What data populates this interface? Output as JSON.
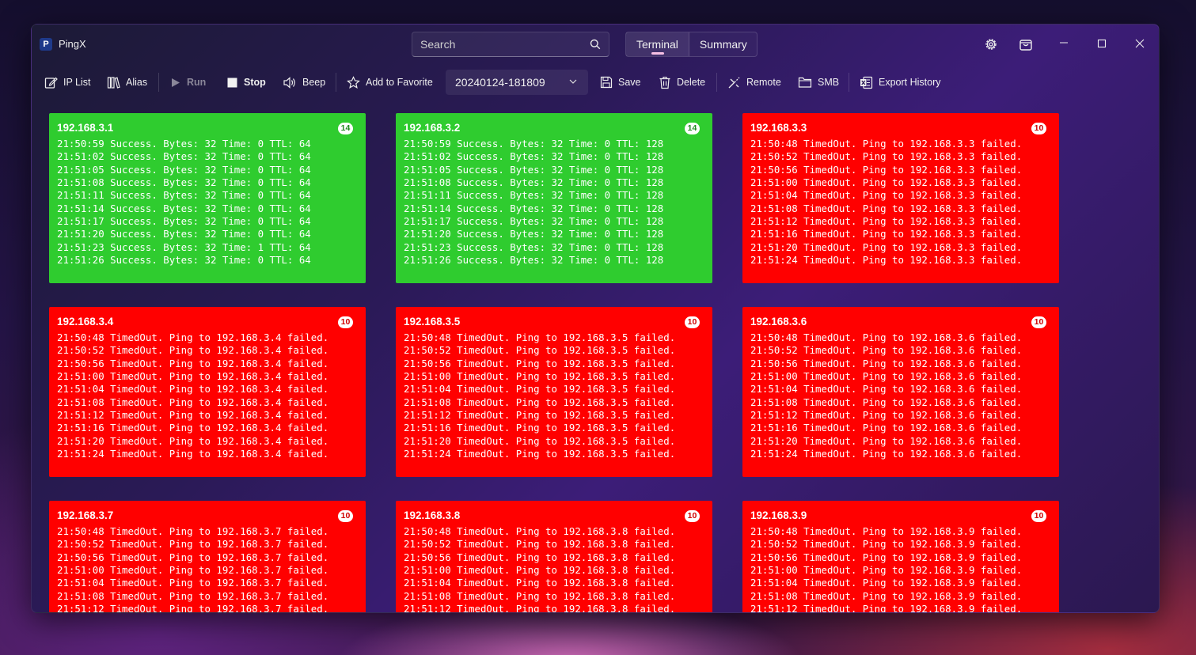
{
  "app": {
    "icon_letter": "P",
    "title": "PingX"
  },
  "search": {
    "placeholder": "Search"
  },
  "tabs": [
    "Terminal",
    "Summary"
  ],
  "toolbar": {
    "ip_list": "IP List",
    "alias": "Alias",
    "run": "Run",
    "stop": "Stop",
    "beep": "Beep",
    "add_favorite": "Add to Favorite",
    "history_selected": "20240124-181809",
    "save": "Save",
    "delete": "Delete",
    "remote": "Remote",
    "smb": "SMB",
    "export_history": "Export History"
  },
  "colors": {
    "success": "#2fcc2f",
    "failure": "#ff0000"
  },
  "cards": [
    {
      "ip": "192.168.3.1",
      "count": "14",
      "status": "success",
      "lines": [
        "21:50:59 Success. Bytes: 32 Time: 0 TTL: 64",
        "21:51:02 Success. Bytes: 32 Time: 0 TTL: 64",
        "21:51:05 Success. Bytes: 32 Time: 0 TTL: 64",
        "21:51:08 Success. Bytes: 32 Time: 0 TTL: 64",
        "21:51:11 Success. Bytes: 32 Time: 0 TTL: 64",
        "21:51:14 Success. Bytes: 32 Time: 0 TTL: 64",
        "21:51:17 Success. Bytes: 32 Time: 0 TTL: 64",
        "21:51:20 Success. Bytes: 32 Time: 0 TTL: 64",
        "21:51:23 Success. Bytes: 32 Time: 1 TTL: 64",
        "21:51:26 Success. Bytes: 32 Time: 0 TTL: 64"
      ]
    },
    {
      "ip": "192.168.3.2",
      "count": "14",
      "status": "success",
      "lines": [
        "21:50:59 Success. Bytes: 32 Time: 0 TTL: 128",
        "21:51:02 Success. Bytes: 32 Time: 0 TTL: 128",
        "21:51:05 Success. Bytes: 32 Time: 0 TTL: 128",
        "21:51:08 Success. Bytes: 32 Time: 0 TTL: 128",
        "21:51:11 Success. Bytes: 32 Time: 0 TTL: 128",
        "21:51:14 Success. Bytes: 32 Time: 0 TTL: 128",
        "21:51:17 Success. Bytes: 32 Time: 0 TTL: 128",
        "21:51:20 Success. Bytes: 32 Time: 0 TTL: 128",
        "21:51:23 Success. Bytes: 32 Time: 0 TTL: 128",
        "21:51:26 Success. Bytes: 32 Time: 0 TTL: 128"
      ]
    },
    {
      "ip": "192.168.3.3",
      "count": "10",
      "status": "failure",
      "lines": [
        "21:50:48 TimedOut. Ping to 192.168.3.3 failed.",
        "21:50:52 TimedOut. Ping to 192.168.3.3 failed.",
        "21:50:56 TimedOut. Ping to 192.168.3.3 failed.",
        "21:51:00 TimedOut. Ping to 192.168.3.3 failed.",
        "21:51:04 TimedOut. Ping to 192.168.3.3 failed.",
        "21:51:08 TimedOut. Ping to 192.168.3.3 failed.",
        "21:51:12 TimedOut. Ping to 192.168.3.3 failed.",
        "21:51:16 TimedOut. Ping to 192.168.3.3 failed.",
        "21:51:20 TimedOut. Ping to 192.168.3.3 failed.",
        "21:51:24 TimedOut. Ping to 192.168.3.3 failed."
      ]
    },
    {
      "ip": "192.168.3.4",
      "count": "10",
      "status": "failure",
      "lines": [
        "21:50:48 TimedOut. Ping to 192.168.3.4 failed.",
        "21:50:52 TimedOut. Ping to 192.168.3.4 failed.",
        "21:50:56 TimedOut. Ping to 192.168.3.4 failed.",
        "21:51:00 TimedOut. Ping to 192.168.3.4 failed.",
        "21:51:04 TimedOut. Ping to 192.168.3.4 failed.",
        "21:51:08 TimedOut. Ping to 192.168.3.4 failed.",
        "21:51:12 TimedOut. Ping to 192.168.3.4 failed.",
        "21:51:16 TimedOut. Ping to 192.168.3.4 failed.",
        "21:51:20 TimedOut. Ping to 192.168.3.4 failed.",
        "21:51:24 TimedOut. Ping to 192.168.3.4 failed."
      ]
    },
    {
      "ip": "192.168.3.5",
      "count": "10",
      "status": "failure",
      "lines": [
        "21:50:48 TimedOut. Ping to 192.168.3.5 failed.",
        "21:50:52 TimedOut. Ping to 192.168.3.5 failed.",
        "21:50:56 TimedOut. Ping to 192.168.3.5 failed.",
        "21:51:00 TimedOut. Ping to 192.168.3.5 failed.",
        "21:51:04 TimedOut. Ping to 192.168.3.5 failed.",
        "21:51:08 TimedOut. Ping to 192.168.3.5 failed.",
        "21:51:12 TimedOut. Ping to 192.168.3.5 failed.",
        "21:51:16 TimedOut. Ping to 192.168.3.5 failed.",
        "21:51:20 TimedOut. Ping to 192.168.3.5 failed.",
        "21:51:24 TimedOut. Ping to 192.168.3.5 failed."
      ]
    },
    {
      "ip": "192.168.3.6",
      "count": "10",
      "status": "failure",
      "lines": [
        "21:50:48 TimedOut. Ping to 192.168.3.6 failed.",
        "21:50:52 TimedOut. Ping to 192.168.3.6 failed.",
        "21:50:56 TimedOut. Ping to 192.168.3.6 failed.",
        "21:51:00 TimedOut. Ping to 192.168.3.6 failed.",
        "21:51:04 TimedOut. Ping to 192.168.3.6 failed.",
        "21:51:08 TimedOut. Ping to 192.168.3.6 failed.",
        "21:51:12 TimedOut. Ping to 192.168.3.6 failed.",
        "21:51:16 TimedOut. Ping to 192.168.3.6 failed.",
        "21:51:20 TimedOut. Ping to 192.168.3.6 failed.",
        "21:51:24 TimedOut. Ping to 192.168.3.6 failed."
      ]
    },
    {
      "ip": "192.168.3.7",
      "count": "10",
      "status": "failure",
      "lines": [
        "21:50:48 TimedOut. Ping to 192.168.3.7 failed.",
        "21:50:52 TimedOut. Ping to 192.168.3.7 failed.",
        "21:50:56 TimedOut. Ping to 192.168.3.7 failed.",
        "21:51:00 TimedOut. Ping to 192.168.3.7 failed.",
        "21:51:04 TimedOut. Ping to 192.168.3.7 failed.",
        "21:51:08 TimedOut. Ping to 192.168.3.7 failed.",
        "21:51:12 TimedOut. Ping to 192.168.3.7 failed."
      ]
    },
    {
      "ip": "192.168.3.8",
      "count": "10",
      "status": "failure",
      "lines": [
        "21:50:48 TimedOut. Ping to 192.168.3.8 failed.",
        "21:50:52 TimedOut. Ping to 192.168.3.8 failed.",
        "21:50:56 TimedOut. Ping to 192.168.3.8 failed.",
        "21:51:00 TimedOut. Ping to 192.168.3.8 failed.",
        "21:51:04 TimedOut. Ping to 192.168.3.8 failed.",
        "21:51:08 TimedOut. Ping to 192.168.3.8 failed.",
        "21:51:12 TimedOut. Ping to 192.168.3.8 failed."
      ]
    },
    {
      "ip": "192.168.3.9",
      "count": "10",
      "status": "failure",
      "lines": [
        "21:50:48 TimedOut. Ping to 192.168.3.9 failed.",
        "21:50:52 TimedOut. Ping to 192.168.3.9 failed.",
        "21:50:56 TimedOut. Ping to 192.168.3.9 failed.",
        "21:51:00 TimedOut. Ping to 192.168.3.9 failed.",
        "21:51:04 TimedOut. Ping to 192.168.3.9 failed.",
        "21:51:08 TimedOut. Ping to 192.168.3.9 failed.",
        "21:51:12 TimedOut. Ping to 192.168.3.9 failed."
      ]
    }
  ]
}
